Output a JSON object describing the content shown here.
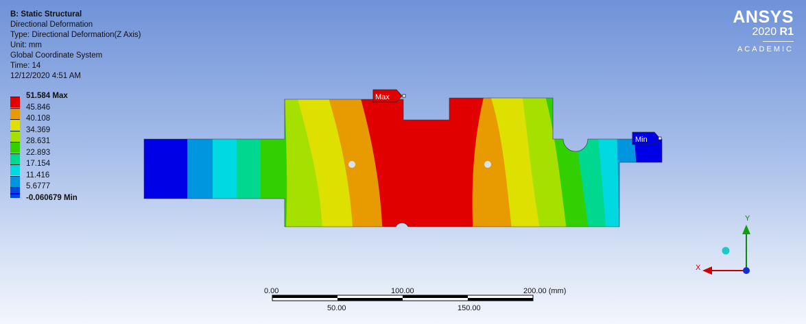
{
  "info": {
    "title": "B: Static Structural",
    "result_name": "Directional Deformation",
    "type_line": "Type: Directional Deformation(Z Axis)",
    "unit_line": "Unit: mm",
    "coord_line": "Global Coordinate System",
    "time_line": "Time: 14",
    "date_line": "12/12/2020 4:51 AM"
  },
  "legend": {
    "entries": [
      {
        "label": "51.584 Max",
        "color": "#e00000"
      },
      {
        "label": "45.846",
        "color": "#e89b00"
      },
      {
        "label": "40.108",
        "color": "#dde000"
      },
      {
        "label": "34.369",
        "color": "#a6e000"
      },
      {
        "label": "28.631",
        "color": "#32d000"
      },
      {
        "label": "22.893",
        "color": "#00d890"
      },
      {
        "label": "17.154",
        "color": "#00d9e0"
      },
      {
        "label": "11.416",
        "color": "#0096df"
      },
      {
        "label": "5.6777",
        "color": "#0048e0"
      },
      {
        "label": "-0.060679 Min",
        "color": "#0000e6"
      }
    ]
  },
  "probes": {
    "max_label": "Max",
    "min_label": "Min"
  },
  "scale_bar": {
    "ticks_top": [
      "0.00",
      "100.00",
      "200.00 (mm)"
    ],
    "ticks_bottom": [
      "50.00",
      "150.00"
    ]
  },
  "triad": {
    "x_label": "X",
    "y_label": "Y"
  },
  "logo": {
    "brand": "ANSYS",
    "version_year": "2020",
    "version_release": "R1",
    "edition": "ACADEMIC"
  }
}
